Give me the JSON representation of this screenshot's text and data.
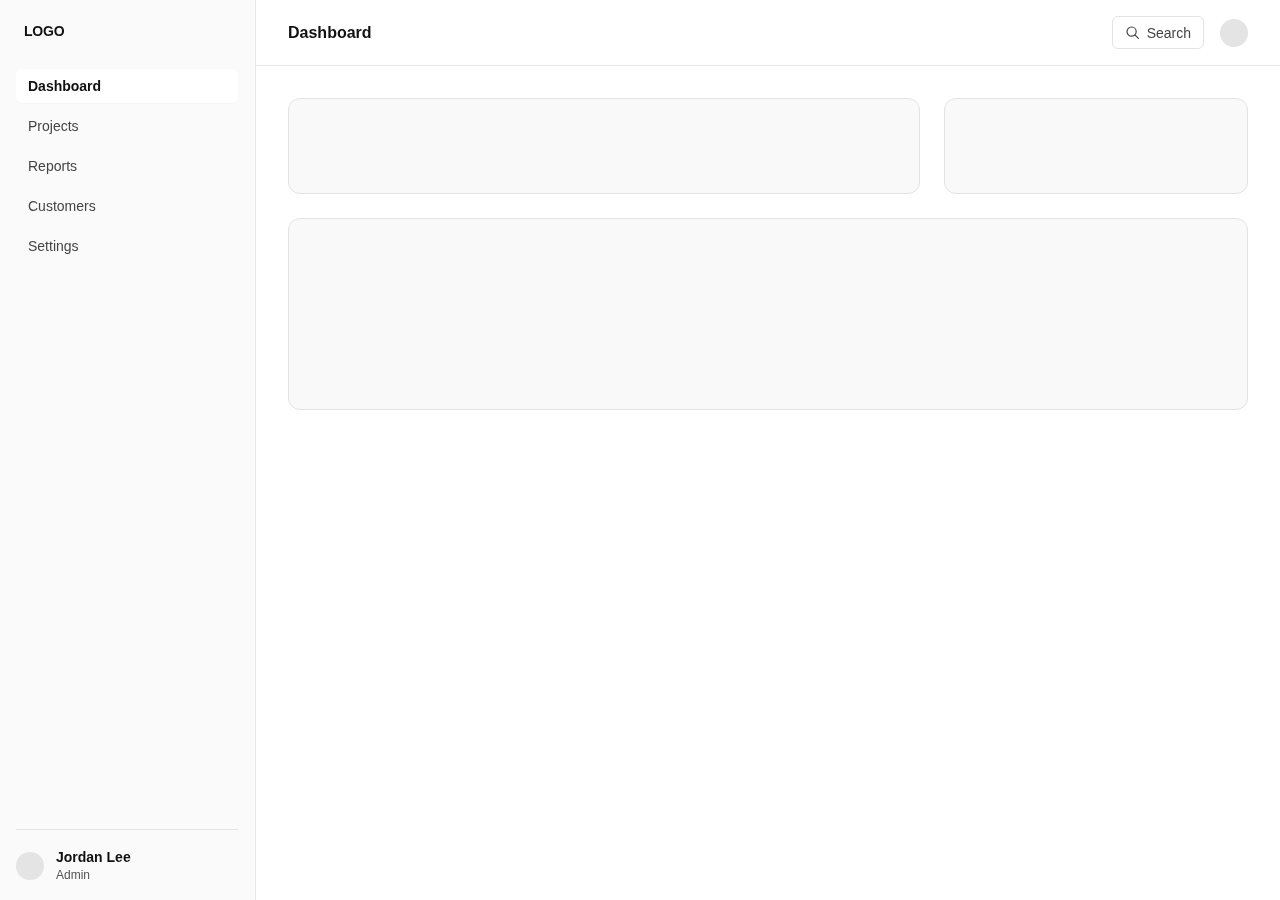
{
  "sidebar": {
    "logo": "LOGO",
    "items": [
      {
        "label": "Dashboard",
        "selected": true
      },
      {
        "label": "Projects",
        "selected": false
      },
      {
        "label": "Reports",
        "selected": false
      },
      {
        "label": "Customers",
        "selected": false
      },
      {
        "label": "Settings",
        "selected": false
      }
    ],
    "user": {
      "name": "Jordan Lee",
      "role": "Admin"
    }
  },
  "header": {
    "title": "Dashboard",
    "search_button": {
      "label": "Search"
    }
  }
}
